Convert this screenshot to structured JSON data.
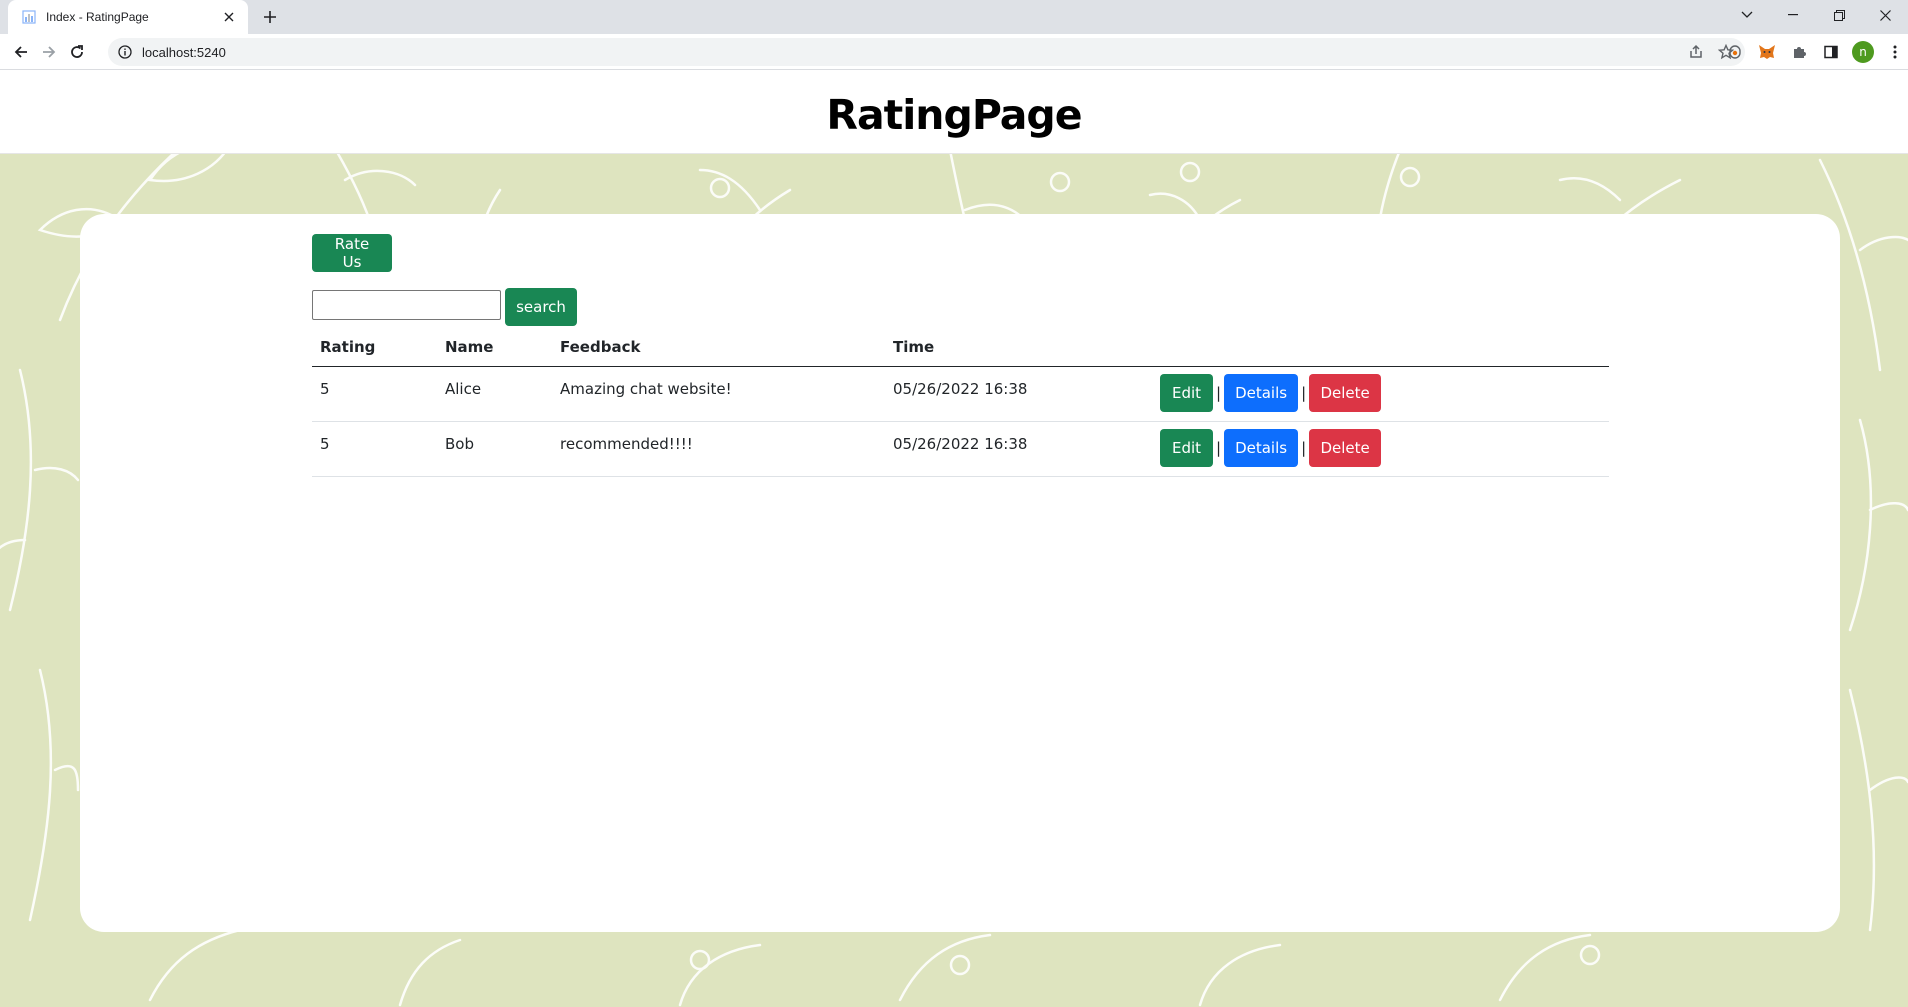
{
  "browser": {
    "tab_title": "Index - RatingPage",
    "url": "localhost:5240",
    "profile_initial": "n"
  },
  "page": {
    "site_title": "RatingPage",
    "rate_button": "Rate Us",
    "search_value": "",
    "search_button": "search",
    "columns": [
      "Rating",
      "Name",
      "Feedback",
      "Time"
    ],
    "rows": [
      {
        "rating": "5",
        "name": "Alice",
        "feedback": "Amazing chat website!",
        "time": "05/26/2022 16:38"
      },
      {
        "rating": "5",
        "name": "Bob",
        "feedback": "recommended!!!!",
        "time": "05/26/2022 16:38"
      }
    ],
    "actions": {
      "edit": "Edit",
      "details": "Details",
      "delete": "Delete",
      "separator": "|"
    }
  },
  "colors": {
    "background": "#dee4bf",
    "btn_green": "#198754",
    "btn_blue": "#0d6efd",
    "btn_red": "#dc3545"
  }
}
